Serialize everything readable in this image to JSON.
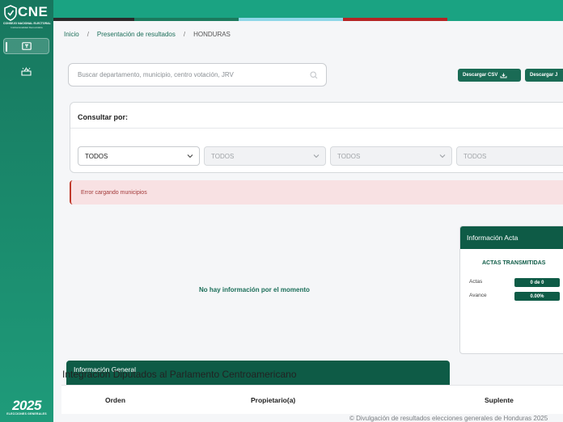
{
  "sidebar": {
    "logo_text": "CNE",
    "logo_sub1": "CONSEJO NACIONAL ELECTORAL",
    "logo_sub2": "Institucionalidad Democrática",
    "year": "2025",
    "year_sub": "ELECCIONES GENERALES"
  },
  "topbar_colors": [
    "#1aa382",
    "#2b2b2b",
    "#1c7a5e",
    "#8ed7e8",
    "#b52525",
    "#1aa382"
  ],
  "breadcrumb": [
    "Inicio",
    "Presentación de resultados",
    "HONDURAS"
  ],
  "search": {
    "placeholder": "Buscar departamento, municipio, centro votación, JRV"
  },
  "downloads": {
    "csv_label": "Descargar CSV",
    "other_label": "Descargar J"
  },
  "consult": {
    "title": "Consultar por:",
    "selects": [
      "TODOS",
      "TODOS",
      "TODOS",
      "TODOS"
    ]
  },
  "alert": {
    "message": "Error cargando municipios"
  },
  "empty_state": "No hay información por el momento",
  "acta": {
    "header": "Información Acta",
    "subtitle": "ACTAS TRANSMITIDAS",
    "rows": [
      {
        "label": "Actas",
        "value": "0 de 0"
      },
      {
        "label": "Avance",
        "value": "0.00%"
      }
    ]
  },
  "info_general": "Información General",
  "integracion": "Integración Diputados al Parlamento Centroamericano",
  "table": {
    "headers": [
      "Orden",
      "Propietario(a)",
      "Suplente"
    ]
  },
  "footer": "© Divulgación de resultados elecciones generales de Honduras 2025"
}
